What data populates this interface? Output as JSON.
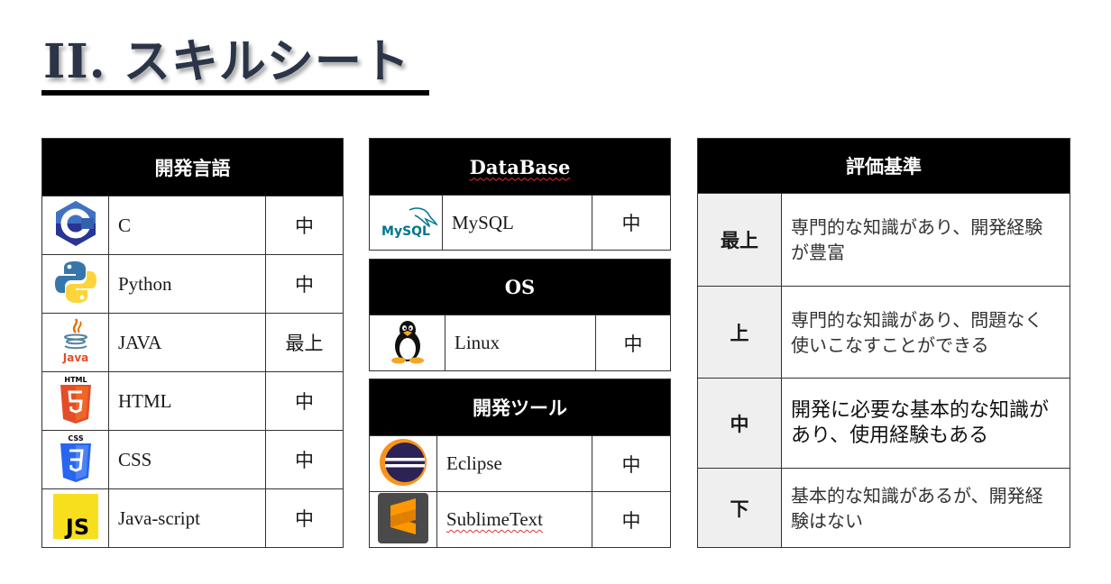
{
  "page": {
    "title": "II. スキルシート"
  },
  "languages": {
    "header": "開発言語",
    "rows": [
      {
        "name": "C",
        "level": "中",
        "icon": "c-language-icon"
      },
      {
        "name": "Python",
        "level": "中",
        "icon": "python-icon"
      },
      {
        "name": "JAVA",
        "level": "最上",
        "icon": "java-icon",
        "icon_text": "Java"
      },
      {
        "name": "HTML",
        "level": "中",
        "icon": "html5-icon",
        "icon_text": "HTML"
      },
      {
        "name": "CSS",
        "level": "中",
        "icon": "css3-icon",
        "icon_text": "CSS"
      },
      {
        "name": "Java-script",
        "level": "中",
        "icon": "javascript-icon",
        "icon_text": "JS"
      }
    ]
  },
  "database": {
    "header": "DataBase",
    "rows": [
      {
        "name": "MySQL",
        "level": "中",
        "icon": "mysql-icon",
        "icon_text": "MySQL"
      }
    ]
  },
  "os": {
    "header": "OS",
    "rows": [
      {
        "name": "Linux",
        "level": "中",
        "icon": "linux-tux-icon"
      }
    ]
  },
  "tools": {
    "header": "開発ツール",
    "rows": [
      {
        "name": "Eclipse",
        "level": "中",
        "icon": "eclipse-icon"
      },
      {
        "name": "SublimeText",
        "level": "中",
        "icon": "sublime-text-icon"
      }
    ]
  },
  "evaluation": {
    "header": "評価基準",
    "rows": [
      {
        "grade": "最上",
        "description": "専門的な知識があり、開発経験が豊富"
      },
      {
        "grade": "上",
        "description": "専門的な知識があり、問題なく使いこなすことができる"
      },
      {
        "grade": "中",
        "description": "開発に必要な基本的な知識があり、使用経験もある"
      },
      {
        "grade": "下",
        "description": "基本的な知識があるが、開発経験はない"
      }
    ]
  },
  "colors": {
    "header_bg": "#000000",
    "title_text": "#2b3547",
    "grade_bg": "#efefef",
    "html5_orange": "#e44d26",
    "css3_blue": "#2965f1",
    "js_yellow": "#f7df1e",
    "c_blue": "#3f73c0",
    "python_blue": "#3776ab",
    "python_yellow": "#ffd43b",
    "mysql_blue": "#00758f",
    "mysql_orange": "#f29111",
    "eclipse_navy": "#2c2255",
    "sublime_orange": "#ff9800"
  }
}
